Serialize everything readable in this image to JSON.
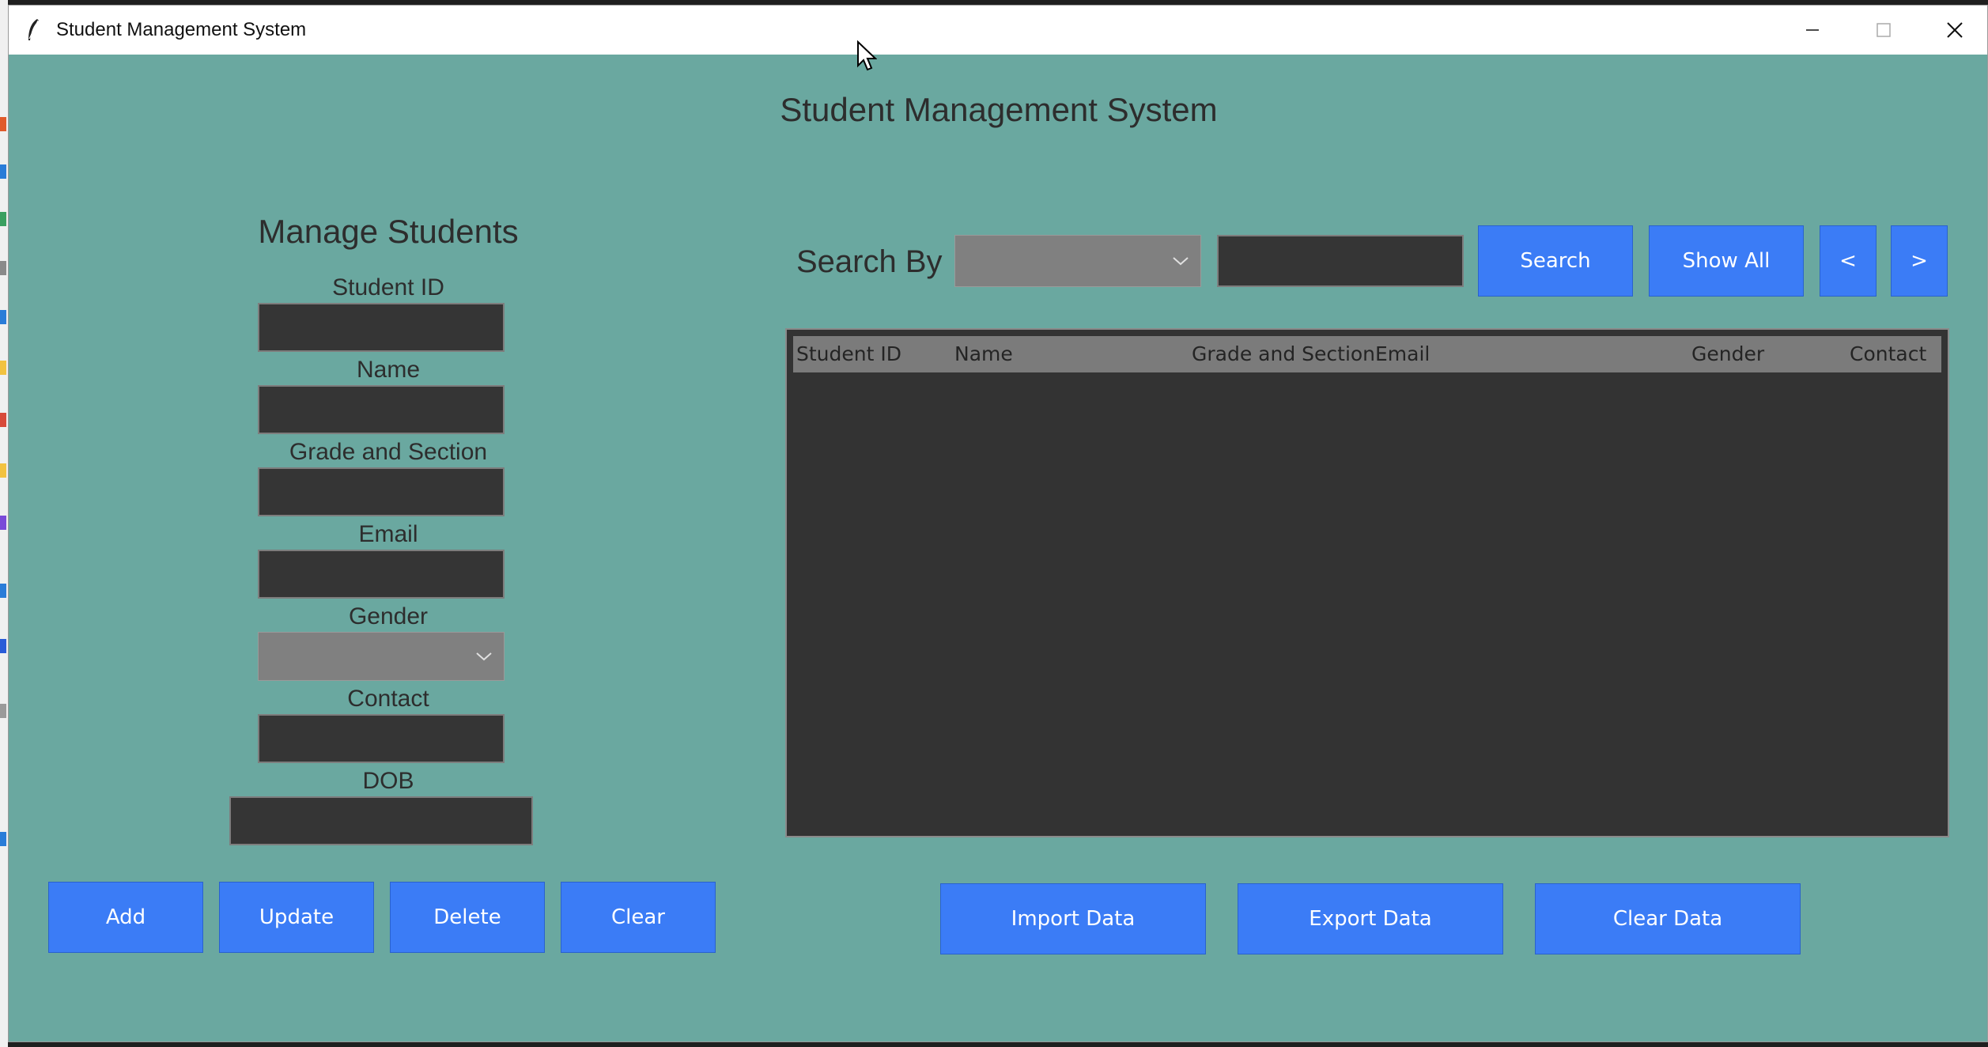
{
  "window": {
    "title": "Student Management System"
  },
  "app": {
    "heading": "Student Management System"
  },
  "manage": {
    "heading": "Manage Students",
    "fields": {
      "student_id": {
        "label": "Student ID",
        "value": ""
      },
      "name": {
        "label": "Name",
        "value": ""
      },
      "grade_section": {
        "label": "Grade and Section",
        "value": ""
      },
      "email": {
        "label": "Email",
        "value": ""
      },
      "gender": {
        "label": "Gender",
        "value": ""
      },
      "contact": {
        "label": "Contact",
        "value": ""
      },
      "dob": {
        "label": "DOB",
        "value": ""
      }
    },
    "buttons": {
      "add": "Add",
      "update": "Update",
      "delete": "Delete",
      "clear": "Clear"
    }
  },
  "search": {
    "label": "Search By",
    "by_value": "",
    "query": "",
    "search_button": "Search",
    "show_all_button": "Show All",
    "prev_button": "<",
    "next_button": ">"
  },
  "table": {
    "columns": [
      "Student ID",
      "Name",
      "Grade and Section",
      "Email",
      "Gender",
      "Contact"
    ],
    "rows": []
  },
  "data_actions": {
    "import": "Import Data",
    "export": "Export Data",
    "clear": "Clear Data"
  },
  "colors": {
    "background": "#6aa8a0",
    "button": "#3b7cf6",
    "input": "#353535",
    "table_bg": "#333333",
    "table_header": "#7b7b7b"
  }
}
